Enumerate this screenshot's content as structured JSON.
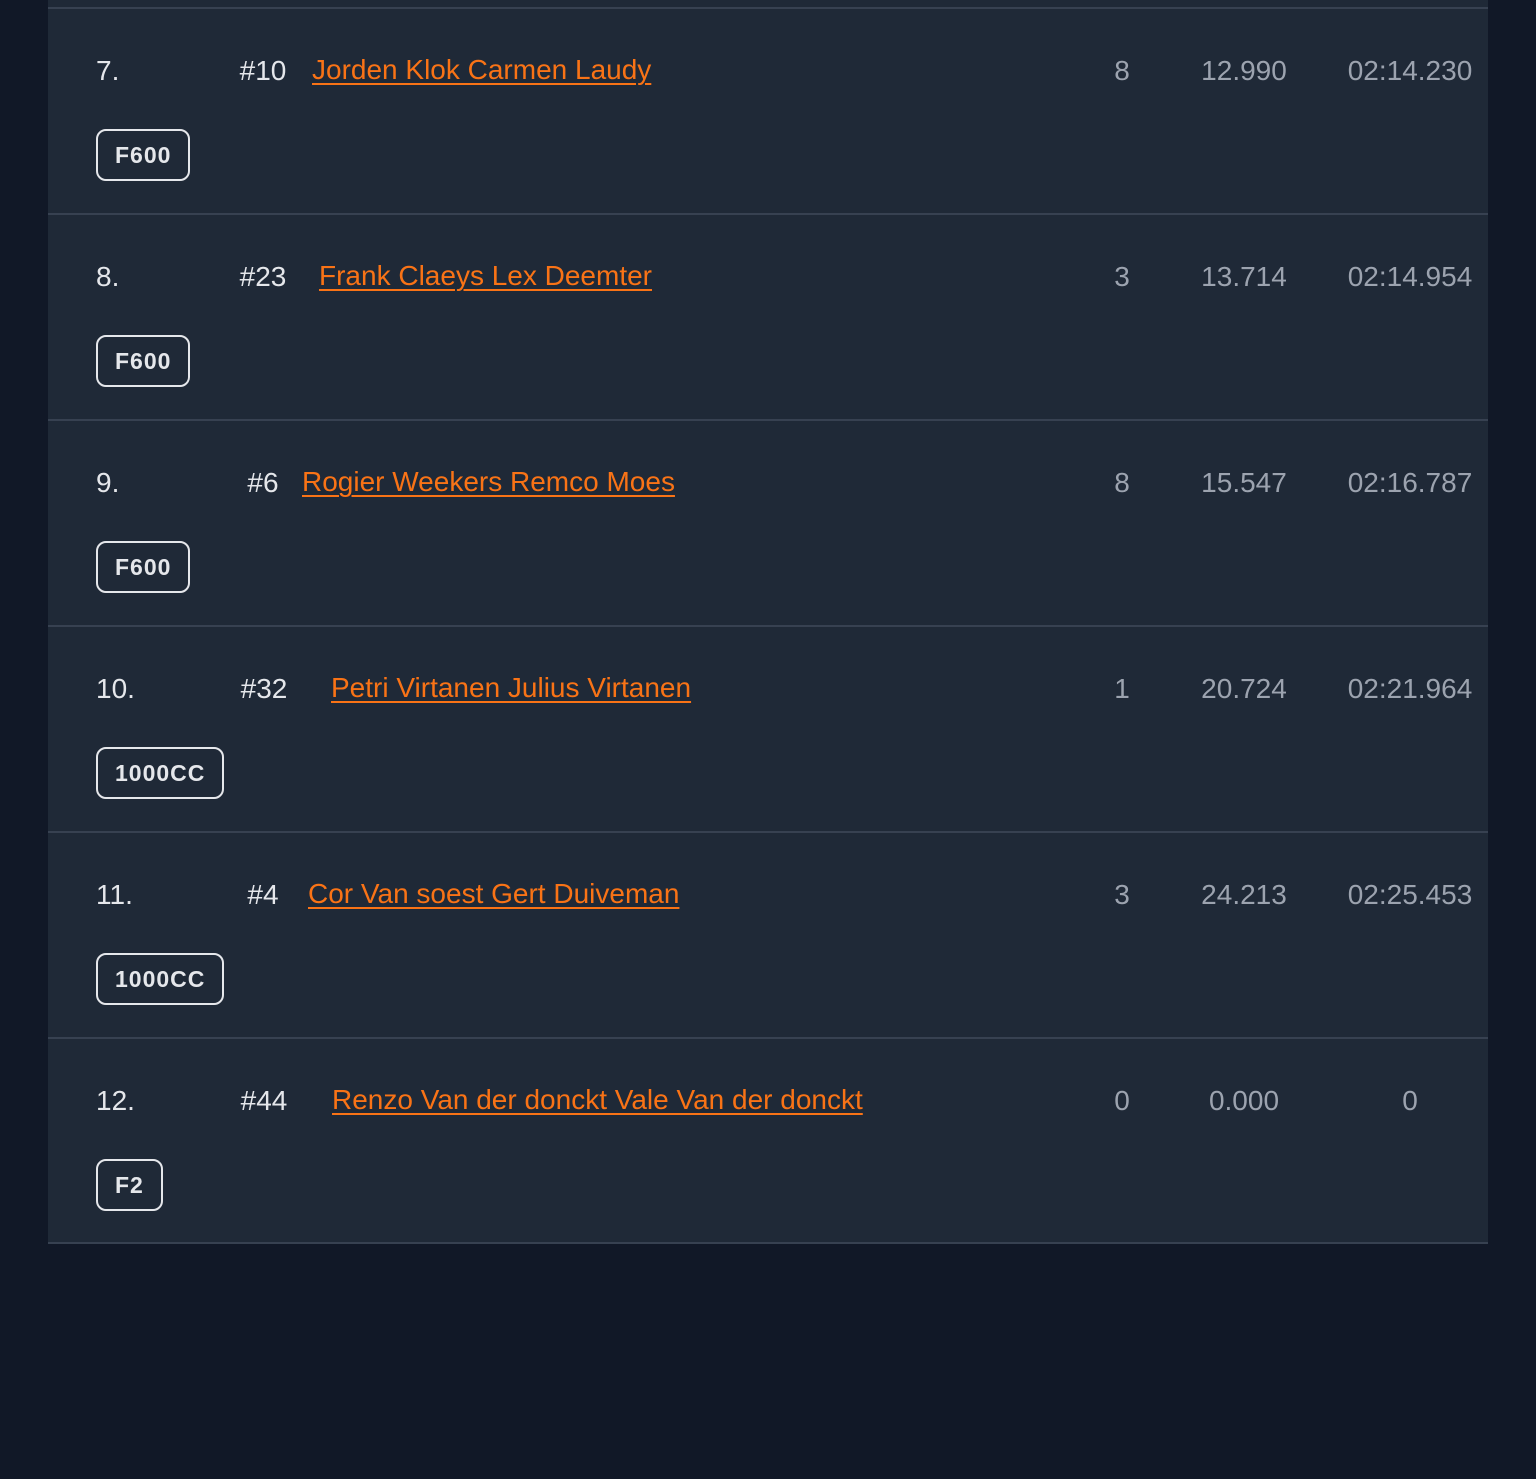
{
  "results": [
    {
      "pos": "7.",
      "car": "#10",
      "drivers": "Jorden Klok Carmen Laudy",
      "laps": "8",
      "gap": "12.990",
      "time": "02:14.230",
      "class": "F600"
    },
    {
      "pos": "8.",
      "car": "#23",
      "drivers": "Frank Claeys Lex Deemter",
      "laps": "3",
      "gap": "13.714",
      "time": "02:14.954",
      "class": "F600"
    },
    {
      "pos": "9.",
      "car": "#6",
      "drivers": "Rogier Weekers Remco Moes",
      "laps": "8",
      "gap": "15.547",
      "time": "02:16.787",
      "class": "F600"
    },
    {
      "pos": "10.",
      "car": "#32",
      "drivers": "Petri Virtanen Julius Virtanen",
      "laps": "1",
      "gap": "20.724",
      "time": "02:21.964",
      "class": "1000CC"
    },
    {
      "pos": "11.",
      "car": "#4",
      "drivers": "Cor Van soest Gert Duiveman",
      "laps": "3",
      "gap": "24.213",
      "time": "02:25.453",
      "class": "1000CC"
    },
    {
      "pos": "12.",
      "car": "#44",
      "drivers": "Renzo Van der donckt Vale Van der donckt",
      "laps": "0",
      "gap": "0.000",
      "time": "0",
      "class": "F2"
    }
  ],
  "colors": {
    "page_bg": "#111827",
    "panel_bg": "#1f2937",
    "divider": "#374151",
    "link": "#f97316",
    "text_primary": "#e5e7eb",
    "text_muted": "#9ca3af"
  }
}
